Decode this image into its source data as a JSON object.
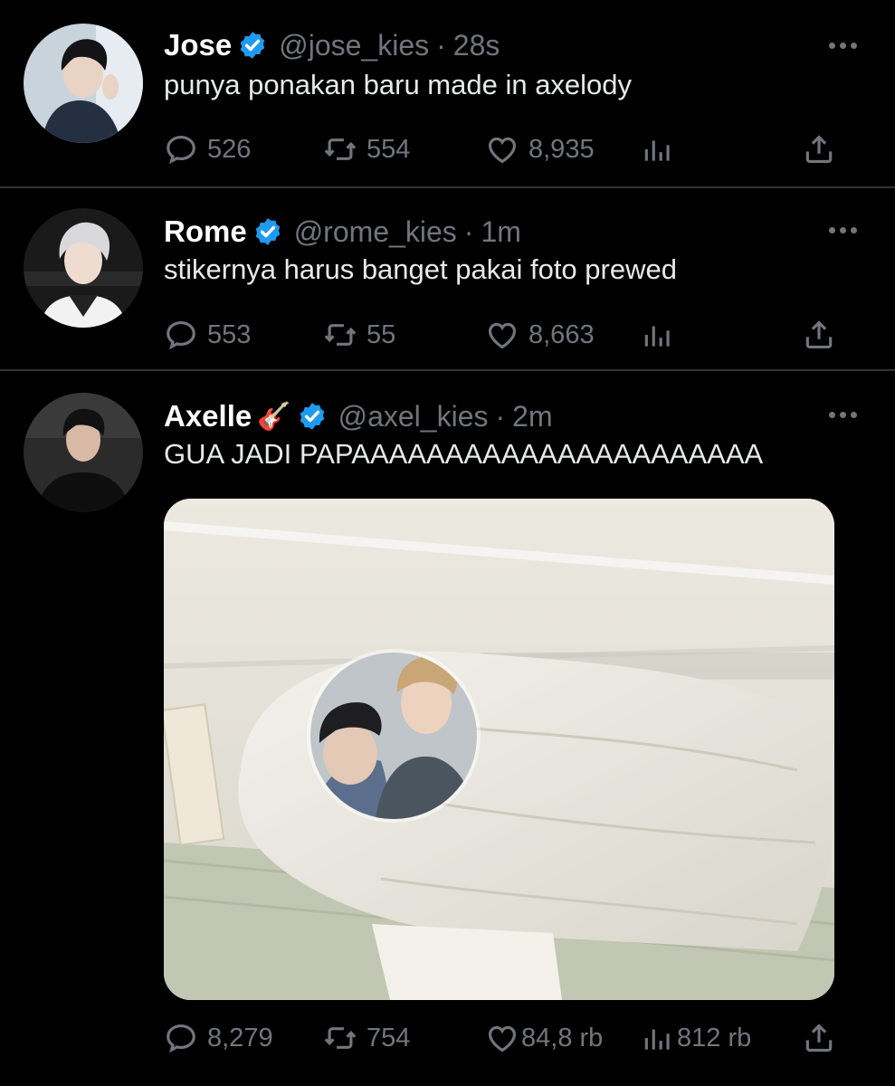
{
  "tweets": [
    {
      "name": "Jose",
      "handle": "@jose_kies",
      "separator": "·",
      "time": "28s",
      "text": "punya ponakan baru made in axelody",
      "replies": "526",
      "retweets": "554",
      "likes": "8,935",
      "views": ""
    },
    {
      "name": "Rome",
      "handle": "@rome_kies",
      "separator": "·",
      "time": "1m",
      "text": "stikernya harus banget pakai foto prewed",
      "replies": "553",
      "retweets": "55",
      "likes": "8,663",
      "views": ""
    },
    {
      "name": "Axelle",
      "name_emoji": "🎸",
      "handle": "@axel_kies",
      "separator": "·",
      "time": "2m",
      "text": "GUA JADI PAPAAAAAAAAAAAAAAAAAAAAAA",
      "replies": "8,279",
      "retweets": "754",
      "likes": "84,8 rb",
      "views": "812 rb"
    }
  ],
  "colors": {
    "background": "#000000",
    "text": "#e7e9ea",
    "muted": "#71767b",
    "verified": "#1d9bf0",
    "divider": "#2f3336"
  },
  "icons": [
    "reply-icon",
    "retweet-icon",
    "like-icon",
    "views-icon",
    "share-icon",
    "more-icon",
    "verified-icon",
    "guitar-emoji"
  ]
}
